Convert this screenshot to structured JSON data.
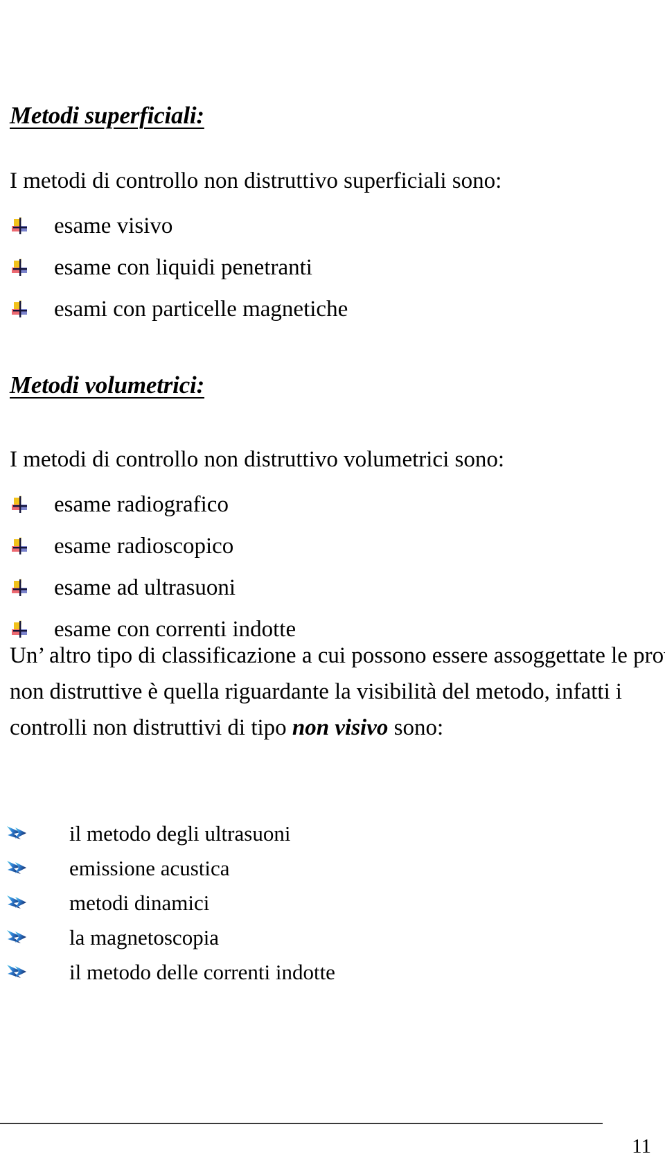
{
  "document": {
    "language": "it",
    "page_number": "11"
  },
  "sections": {
    "superficiali": {
      "heading": "Metodi superficiali:",
      "intro": "I metodi di controllo non distruttivo superficiali sono:",
      "bullet_icon": "colored-cross-bullet-icon",
      "items": [
        "esame visivo",
        "esame con liquidi penetranti",
        "esami con particelle magnetiche"
      ]
    },
    "volumetrici": {
      "heading": "Metodi volumetrici:",
      "intro": "I metodi di controllo non distruttivo volumetrici sono:",
      "bullet_icon": "colored-cross-bullet-icon",
      "items": [
        "esame radiografico",
        "esame radioscopico",
        "esame ad ultrasuoni",
        "esame con correnti indotte"
      ]
    },
    "paragraph": {
      "line1": "Un’ altro tipo di classificazione a cui possono essere assoggettate le prove",
      "line2_parts": [
        "non",
        "distruttive",
        "è",
        "quella",
        "riguardante",
        "la",
        "visibilità",
        "del",
        "metodo,",
        "infatti",
        "i"
      ],
      "line3_prefix": "controlli non distruttivi di tipo ",
      "line3_emphasis": "non visivo",
      "line3_suffix": " sono:"
    },
    "non_visivo": {
      "bullet_icon": "blue-arrow-bullet-icon",
      "items": [
        "il metodo degli ultrasuoni",
        "emissione acustica",
        "metodi dinamici",
        "la magnetoscopia",
        "il metodo delle correnti indotte"
      ]
    }
  },
  "colors": {
    "bullet_yellow": "#f5c518",
    "bullet_red": "#e8586a",
    "bullet_blue": "#6b72c8",
    "bullet_dark": "#1b1b3a",
    "arrow_light": "#3fb4d8",
    "arrow_mid": "#2b6fd0",
    "arrow_dark": "#1b3a8f",
    "rule": "#3a3a3a",
    "text": "#000000"
  }
}
